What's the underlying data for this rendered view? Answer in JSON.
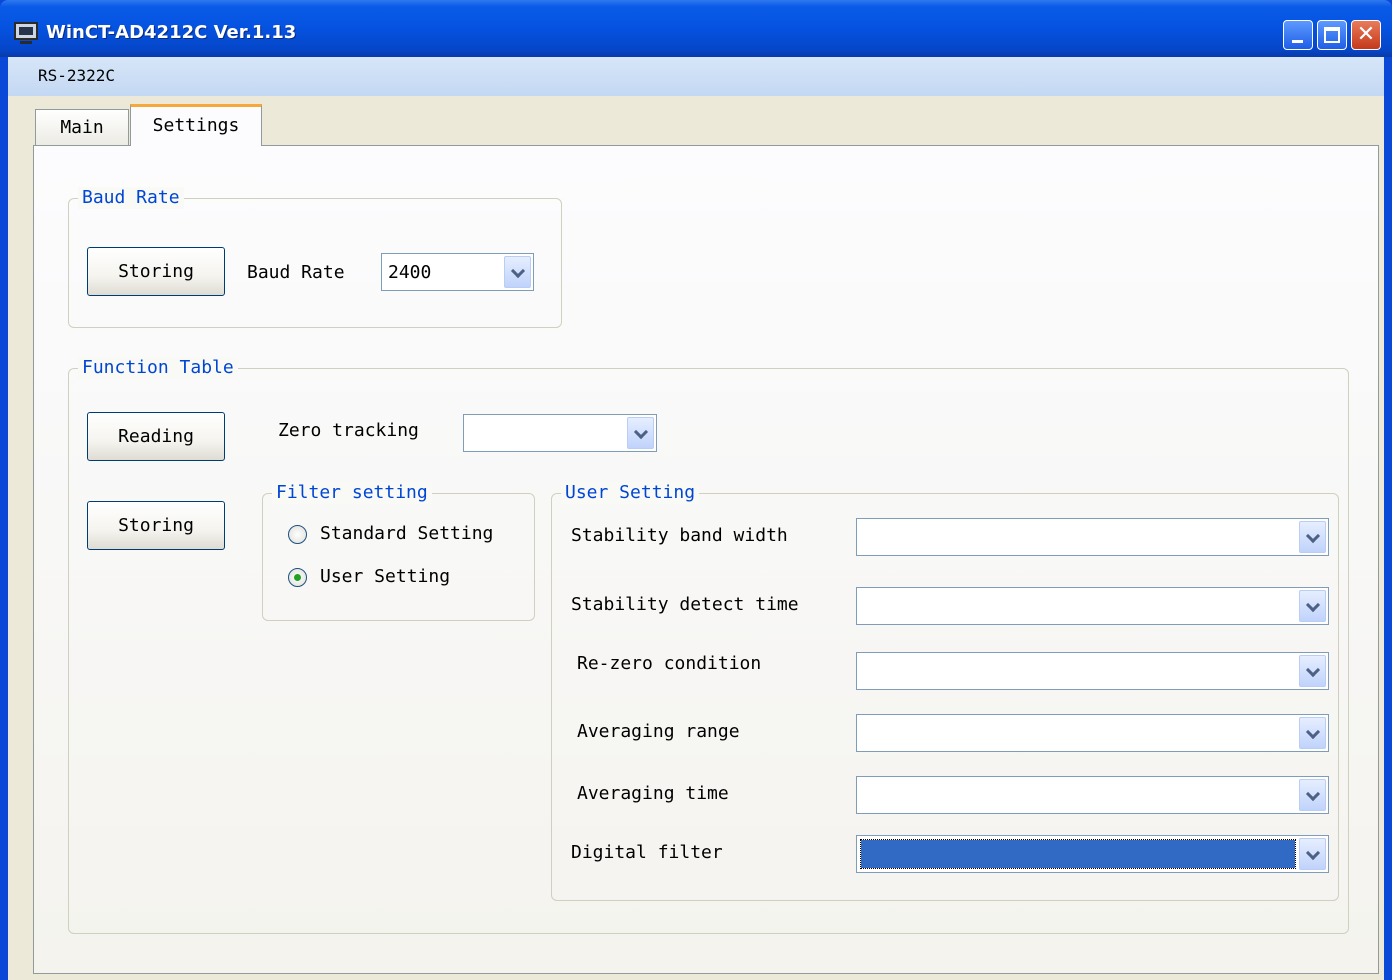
{
  "window": {
    "title": "WinCT-AD4212C Ver.1.13",
    "controls": {
      "minimize_icon": "minimize-icon",
      "maximize_icon": "maximize-icon",
      "close_glyph": "✕"
    }
  },
  "menubar": {
    "items": [
      {
        "label": "RS-2322C"
      }
    ]
  },
  "tabs": [
    {
      "label": "Main",
      "active": false
    },
    {
      "label": "Settings",
      "active": true
    }
  ],
  "baud_rate_group": {
    "legend": "Baud Rate",
    "storing_button": "Storing",
    "baud_rate_label": "Baud Rate",
    "baud_rate_value": "2400"
  },
  "function_table": {
    "legend": "Function Table",
    "reading_button": "Reading",
    "storing_button": "Storing",
    "zero_tracking_label": "Zero tracking",
    "zero_tracking_value": "",
    "filter_setting": {
      "legend": "Filter setting",
      "options": [
        {
          "label": "Standard Setting",
          "checked": false
        },
        {
          "label": "User Setting",
          "checked": true
        }
      ]
    },
    "user_setting": {
      "legend": "User Setting",
      "fields": [
        {
          "label": "Stability band width",
          "value": ""
        },
        {
          "label": "Stability detect time",
          "value": ""
        },
        {
          "label": "Re-zero condition",
          "value": ""
        },
        {
          "label": "Averaging range",
          "value": ""
        },
        {
          "label": "Averaging time",
          "value": ""
        },
        {
          "label": "Digital filter",
          "value": "",
          "selected": true
        }
      ]
    }
  },
  "colors": {
    "titlebar": "#0552e0",
    "group_legend": "#0046d5",
    "selection": "#316ac5",
    "active_tab_accent": "#f7a83a"
  }
}
